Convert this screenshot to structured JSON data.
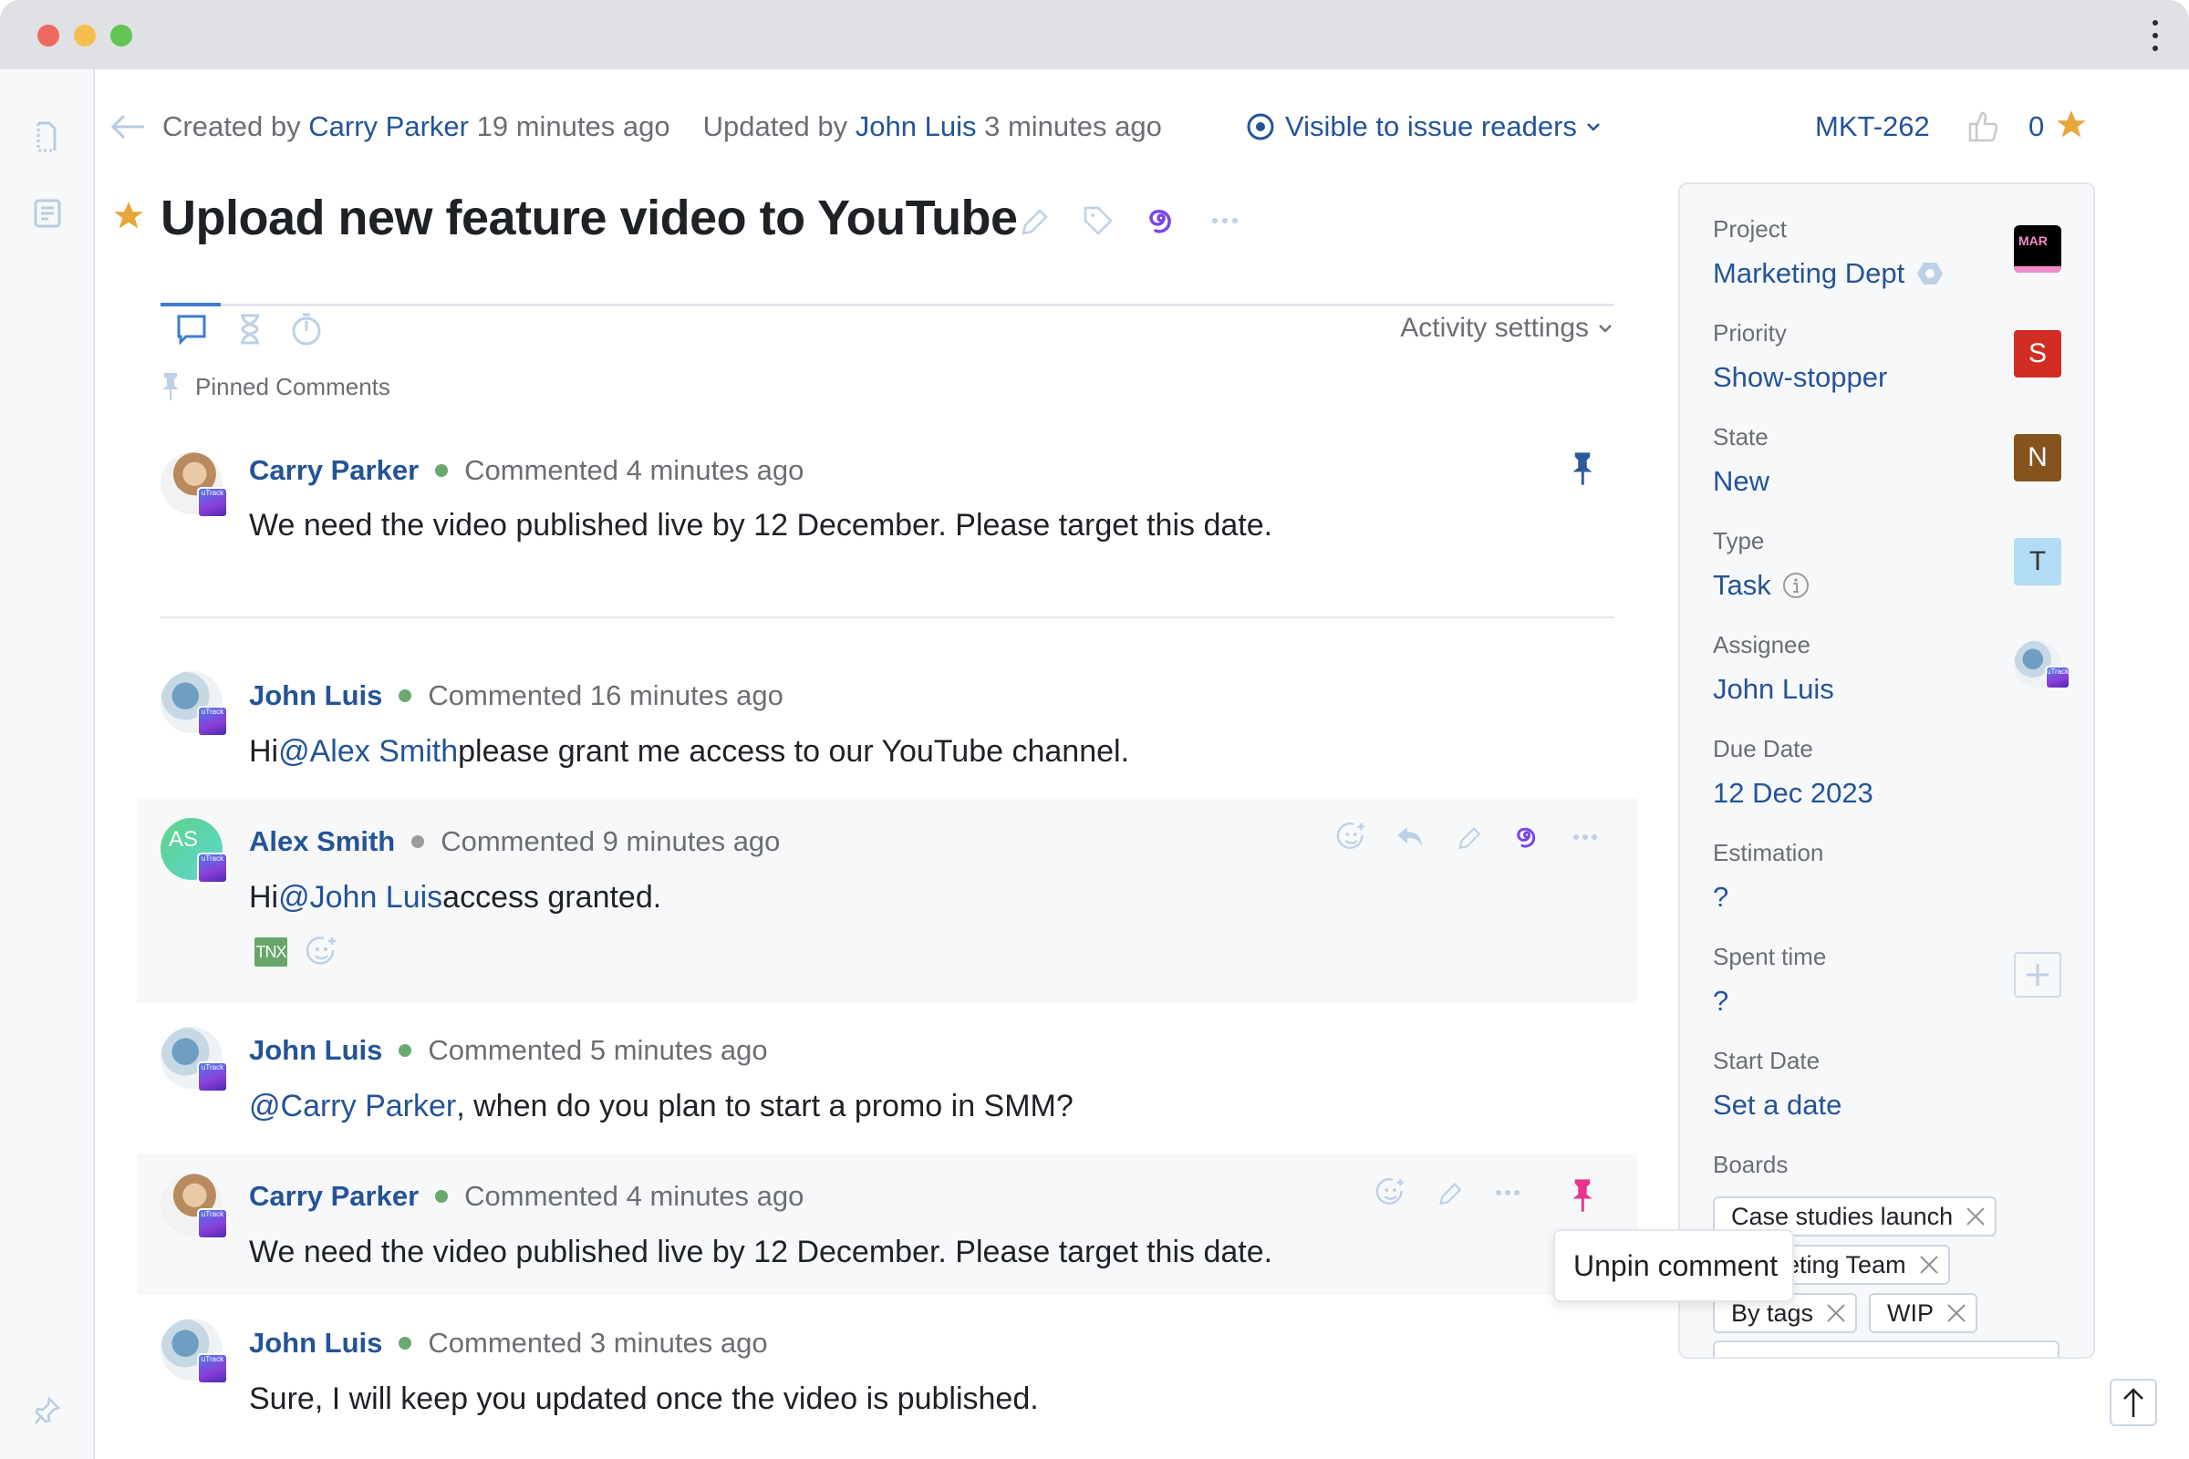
{
  "window": {
    "controls": [
      "close",
      "minimize",
      "maximize"
    ],
    "menu_icon": "kebab-menu-icon"
  },
  "sidebar": {
    "items": [
      {
        "name": "document-icon"
      },
      {
        "name": "article-icon"
      }
    ],
    "bottom_icon": "pin-icon"
  },
  "header": {
    "created_prefix": "Created by",
    "created_by": "Carry Parker",
    "created_ago": "19 minutes ago",
    "updated_prefix": "Updated by",
    "updated_by": "John Luis",
    "updated_ago": "3 minutes ago",
    "visibility": "Visible to issue readers",
    "issue_id": "MKT-262",
    "vote_count": "0"
  },
  "issue": {
    "title": "Upload new feature video to YouTube",
    "starred": true
  },
  "activity": {
    "tabs": [
      {
        "name": "comments",
        "icon": "comment-icon",
        "active": true
      },
      {
        "name": "history",
        "icon": "hourglass-icon",
        "active": false
      },
      {
        "name": "time-tracking",
        "icon": "timer-icon",
        "active": false
      }
    ],
    "settings_label": "Activity settings",
    "pinned_header": "Pinned Comments"
  },
  "pinned_comment": {
    "author": "Carry Parker",
    "online": true,
    "time": "Commented 4 minutes ago",
    "text": "We need the video published live by 12 December. Please target this date."
  },
  "comments": [
    {
      "author": "John Luis",
      "online": true,
      "time": "Commented 16 minutes ago",
      "pre": "Hi ",
      "mention": "@Alex Smith",
      "post": " please grant me access to our YouTube channel."
    },
    {
      "author": "Alex Smith",
      "initials": "AS",
      "online": false,
      "time": "Commented 9 minutes ago",
      "pre": "Hi ",
      "mention": "@John Luis",
      "post": " access granted.",
      "reactions": [
        "TNX"
      ]
    },
    {
      "author": "John Luis",
      "online": true,
      "time": "Commented 5 minutes ago",
      "pre": "",
      "mention": "@Carry Parker",
      "post": ", when do you plan to start a promo in SMM?"
    },
    {
      "author": "Carry Parker",
      "online": true,
      "time": "Commented 4 minutes ago",
      "pre": "We need the video published live by 12 December. Please target this date.",
      "mention": "",
      "post": "",
      "pinned": true
    },
    {
      "author": "John Luis",
      "online": true,
      "time": "Commented 3 minutes ago",
      "pre": "Sure, I will keep you updated once the video is published.",
      "mention": "",
      "post": ""
    }
  ],
  "tooltip": "Unpin comment",
  "fields": {
    "project": {
      "label": "Project",
      "value": "Marketing Dept",
      "badge": "MAR"
    },
    "priority": {
      "label": "Priority",
      "value": "Show-stopper",
      "badge": "S",
      "color": "#d12d22"
    },
    "state": {
      "label": "State",
      "value": "New",
      "badge": "N",
      "color": "#85531e"
    },
    "type": {
      "label": "Type",
      "value": "Task",
      "badge": "T",
      "color": "#b3dcf6"
    },
    "assignee": {
      "label": "Assignee",
      "value": "John Luis"
    },
    "due_date": {
      "label": "Due Date",
      "value": "12 Dec 2023"
    },
    "estimation": {
      "label": "Estimation",
      "value": "?"
    },
    "spent_time": {
      "label": "Spent time",
      "value": "?"
    },
    "start_date": {
      "label": "Start Date",
      "value": "Set a date"
    },
    "boards": {
      "label": "Boards",
      "items": [
        "Case studies launch",
        "Marketing Team",
        "By tags",
        "WIP"
      ]
    }
  },
  "colors": {
    "link": "#245497",
    "accent_purple": "#7b45e7",
    "star": "#e8a63a",
    "online": "#6aaa6e",
    "offline": "#9c9c9c",
    "pin_active": "#e8348c",
    "pin_pinned": "#2a5a9a"
  }
}
